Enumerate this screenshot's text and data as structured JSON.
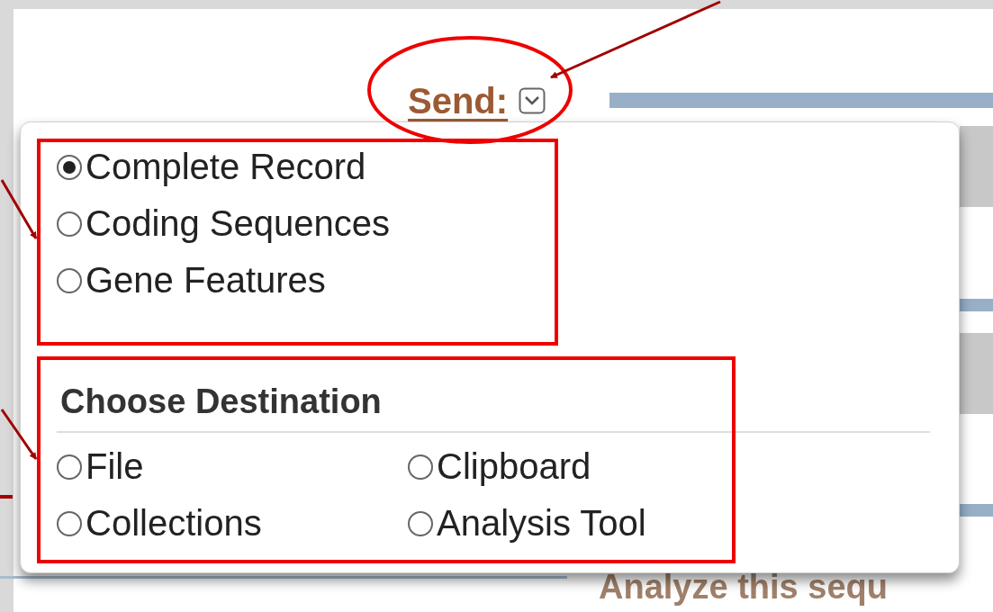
{
  "send": {
    "label": "Send:"
  },
  "record_options": [
    {
      "label": "Complete Record",
      "selected": true
    },
    {
      "label": "Coding Sequences",
      "selected": false
    },
    {
      "label": "Gene Features",
      "selected": false
    }
  ],
  "destination": {
    "title": "Choose Destination",
    "options": [
      {
        "label": "File",
        "selected": false
      },
      {
        "label": "Clipboard",
        "selected": false
      },
      {
        "label": "Collections",
        "selected": false
      },
      {
        "label": "Analysis Tool",
        "selected": false
      }
    ]
  },
  "background_heading": "Analyze this sequ"
}
